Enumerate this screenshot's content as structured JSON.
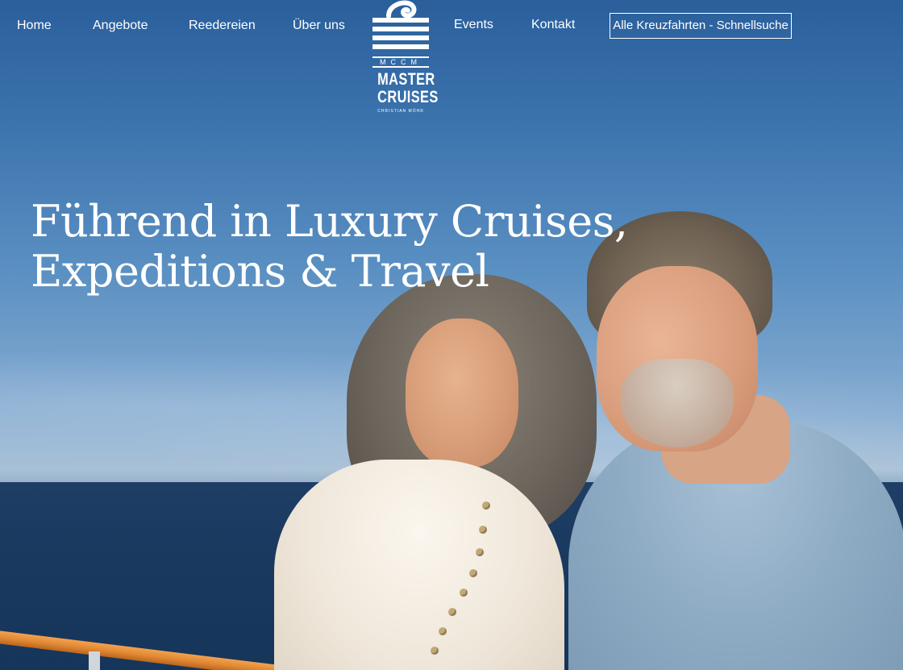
{
  "nav": {
    "items": [
      {
        "label": "Home"
      },
      {
        "label": "Angebote"
      },
      {
        "label": "Reedereien"
      },
      {
        "label": "Über uns"
      },
      {
        "label": "Events"
      },
      {
        "label": "Kontakt"
      }
    ],
    "quick_search_label": "Alle Kreuzfahrten - Schnellsuche"
  },
  "logo": {
    "monogram": "MCCM",
    "line1": "MASTER",
    "line2": "CRUISES",
    "tagline": "CHRISTIAN MÖHR"
  },
  "hero": {
    "headline_line1": "Führend in Luxury Cruises,",
    "headline_line2": "Expeditions & Travel"
  },
  "colors": {
    "nav_text": "#ffffff",
    "sky_top": "#2a5f9c",
    "sea": "#1a3a60"
  }
}
